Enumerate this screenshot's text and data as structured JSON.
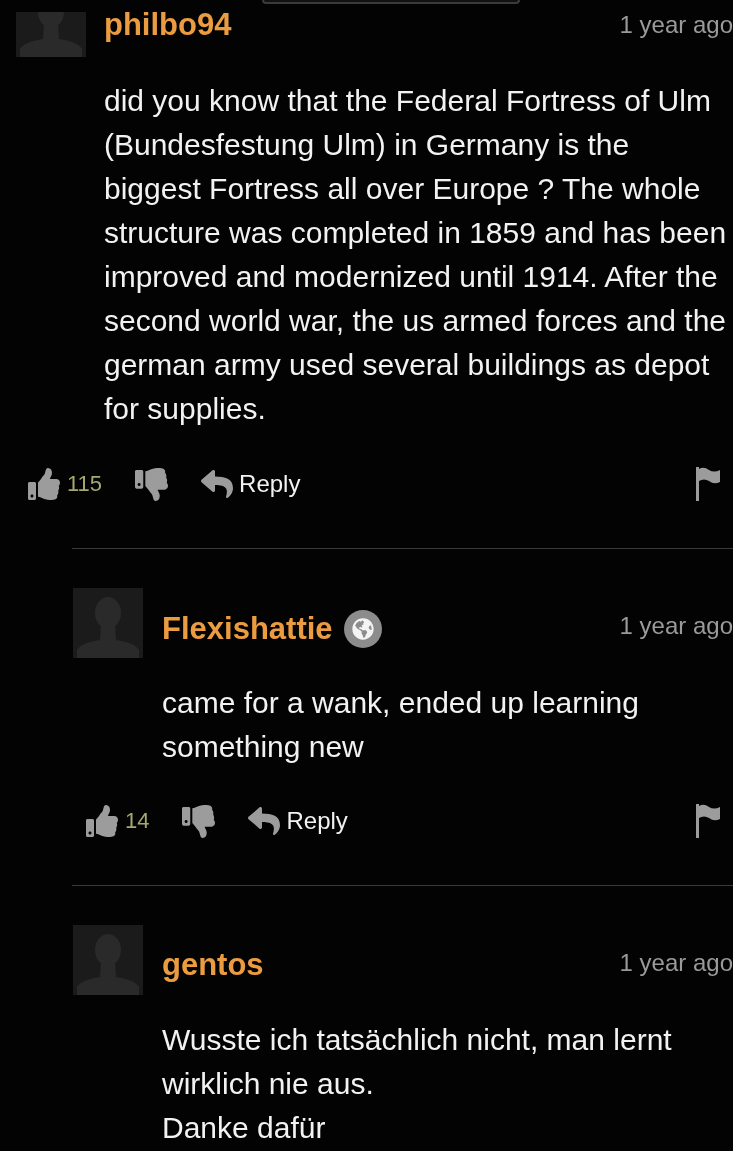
{
  "comments": [
    {
      "user": "philbo94",
      "badge": false,
      "time": "1 year ago",
      "body": "did you know that the Federal Fortress of Ulm (Bundesfestung Ulm) in Germany is the biggest Fortress all over Europe ? The whole structure was completed in 1859 and has been improved and modernized until 1914. After the second world war, the us armed forces and the german army used several buildings as depot for supplies.",
      "likes": "115",
      "reply_label": "Reply",
      "replies": [
        {
          "user": "Flexishattie",
          "badge": true,
          "time": "1 year ago",
          "body": "came for a wank, ended up learning something new",
          "likes": "14",
          "reply_label": "Reply"
        },
        {
          "user": "gentos",
          "badge": false,
          "time": "1 year ago",
          "body": "Wusste ich tatsächlich nicht, man lernt wirklich nie aus.\nDanke dafür"
        }
      ]
    }
  ]
}
